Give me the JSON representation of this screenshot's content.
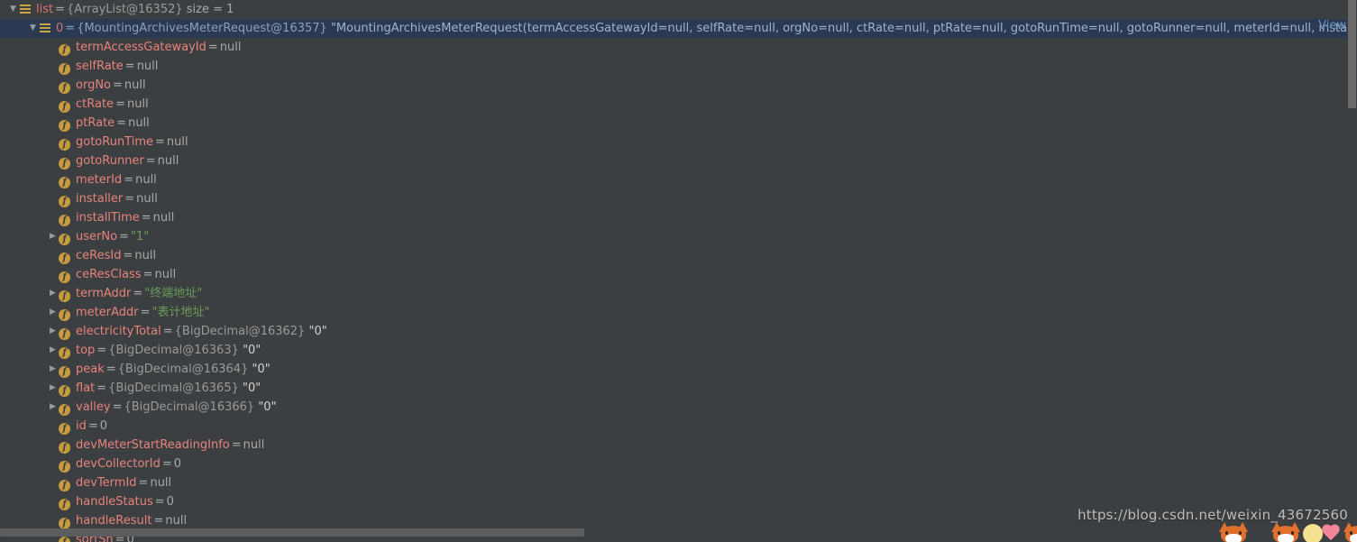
{
  "panel": {
    "background_color": "#3c3f41",
    "selection_color": "#2a3a52",
    "field_name_color": "#e8837b",
    "string_value_color": "#6a9c5a",
    "icon_gold_color": "#c79b3e"
  },
  "symbols": {
    "expanded": "▼",
    "collapsed": "▶",
    "field_icon_letter": "f",
    "equals": "=",
    "ellipsis": "…"
  },
  "rows": [
    {
      "indent": 0,
      "twisty": "expanded",
      "icon": "list-icon",
      "name": "list",
      "type": "{ArrayList@16352}",
      "value": "",
      "value_kind": "none",
      "extra": "size = 1",
      "selected": false
    },
    {
      "indent": 1,
      "twisty": "expanded",
      "icon": "list-icon",
      "name": "0",
      "type": "{MountingArchivesMeterRequest@16357}",
      "value": "\"MountingArchivesMeterRequest(termAccessGatewayId=null, selfRate=null, orgNo=null, ctRate=null, ptRate=null, gotoRunTime=null, gotoRunner=null, meterId=null, installer=null, installTime=nul",
      "value_kind": "desc",
      "extra": "",
      "selected": true
    },
    {
      "indent": 2,
      "twisty": "none",
      "icon": "field-icon",
      "name": "termAccessGatewayId",
      "type": "",
      "value": "null",
      "value_kind": "null",
      "extra": "",
      "selected": false
    },
    {
      "indent": 2,
      "twisty": "none",
      "icon": "field-icon",
      "name": "selfRate",
      "type": "",
      "value": "null",
      "value_kind": "null",
      "extra": "",
      "selected": false
    },
    {
      "indent": 2,
      "twisty": "none",
      "icon": "field-icon",
      "name": "orgNo",
      "type": "",
      "value": "null",
      "value_kind": "null",
      "extra": "",
      "selected": false
    },
    {
      "indent": 2,
      "twisty": "none",
      "icon": "field-icon",
      "name": "ctRate",
      "type": "",
      "value": "null",
      "value_kind": "null",
      "extra": "",
      "selected": false
    },
    {
      "indent": 2,
      "twisty": "none",
      "icon": "field-icon",
      "name": "ptRate",
      "type": "",
      "value": "null",
      "value_kind": "null",
      "extra": "",
      "selected": false
    },
    {
      "indent": 2,
      "twisty": "none",
      "icon": "field-icon",
      "name": "gotoRunTime",
      "type": "",
      "value": "null",
      "value_kind": "null",
      "extra": "",
      "selected": false
    },
    {
      "indent": 2,
      "twisty": "none",
      "icon": "field-icon",
      "name": "gotoRunner",
      "type": "",
      "value": "null",
      "value_kind": "null",
      "extra": "",
      "selected": false
    },
    {
      "indent": 2,
      "twisty": "none",
      "icon": "field-icon",
      "name": "meterId",
      "type": "",
      "value": "null",
      "value_kind": "null",
      "extra": "",
      "selected": false
    },
    {
      "indent": 2,
      "twisty": "none",
      "icon": "field-icon",
      "name": "installer",
      "type": "",
      "value": "null",
      "value_kind": "null",
      "extra": "",
      "selected": false
    },
    {
      "indent": 2,
      "twisty": "none",
      "icon": "field-icon",
      "name": "installTime",
      "type": "",
      "value": "null",
      "value_kind": "null",
      "extra": "",
      "selected": false
    },
    {
      "indent": 2,
      "twisty": "collapsed",
      "icon": "field-icon",
      "name": "userNo",
      "type": "",
      "value": "\"1\"",
      "value_kind": "string",
      "extra": "",
      "selected": false
    },
    {
      "indent": 2,
      "twisty": "none",
      "icon": "field-icon",
      "name": "ceResId",
      "type": "",
      "value": "null",
      "value_kind": "null",
      "extra": "",
      "selected": false
    },
    {
      "indent": 2,
      "twisty": "none",
      "icon": "field-icon",
      "name": "ceResClass",
      "type": "",
      "value": "null",
      "value_kind": "null",
      "extra": "",
      "selected": false
    },
    {
      "indent": 2,
      "twisty": "collapsed",
      "icon": "field-icon",
      "name": "termAddr",
      "type": "",
      "value": "\"终端地址\"",
      "value_kind": "string",
      "extra": "",
      "selected": false
    },
    {
      "indent": 2,
      "twisty": "collapsed",
      "icon": "field-icon",
      "name": "meterAddr",
      "type": "",
      "value": "\"表计地址\"",
      "value_kind": "string",
      "extra": "",
      "selected": false
    },
    {
      "indent": 2,
      "twisty": "collapsed",
      "icon": "field-icon",
      "name": "electricityTotal",
      "type": "{BigDecimal@16362}",
      "value": "\"0\"",
      "value_kind": "plain",
      "extra": "",
      "selected": false
    },
    {
      "indent": 2,
      "twisty": "collapsed",
      "icon": "field-icon",
      "name": "top",
      "type": "{BigDecimal@16363}",
      "value": "\"0\"",
      "value_kind": "plain",
      "extra": "",
      "selected": false
    },
    {
      "indent": 2,
      "twisty": "collapsed",
      "icon": "field-icon",
      "name": "peak",
      "type": "{BigDecimal@16364}",
      "value": "\"0\"",
      "value_kind": "plain",
      "extra": "",
      "selected": false
    },
    {
      "indent": 2,
      "twisty": "collapsed",
      "icon": "field-icon",
      "name": "flat",
      "type": "{BigDecimal@16365}",
      "value": "\"0\"",
      "value_kind": "plain",
      "extra": "",
      "selected": false
    },
    {
      "indent": 2,
      "twisty": "collapsed",
      "icon": "field-icon",
      "name": "valley",
      "type": "{BigDecimal@16366}",
      "value": "\"0\"",
      "value_kind": "plain",
      "extra": "",
      "selected": false
    },
    {
      "indent": 2,
      "twisty": "none",
      "icon": "field-icon",
      "name": "id",
      "type": "",
      "value": "0",
      "value_kind": "num",
      "extra": "",
      "selected": false
    },
    {
      "indent": 2,
      "twisty": "none",
      "icon": "field-icon",
      "name": "devMeterStartReadingInfo",
      "type": "",
      "value": "null",
      "value_kind": "null",
      "extra": "",
      "selected": false
    },
    {
      "indent": 2,
      "twisty": "none",
      "icon": "field-icon",
      "name": "devCollectorId",
      "type": "",
      "value": "0",
      "value_kind": "num",
      "extra": "",
      "selected": false
    },
    {
      "indent": 2,
      "twisty": "none",
      "icon": "field-icon",
      "name": "devTermId",
      "type": "",
      "value": "null",
      "value_kind": "null",
      "extra": "",
      "selected": false
    },
    {
      "indent": 2,
      "twisty": "none",
      "icon": "field-icon",
      "name": "handleStatus",
      "type": "",
      "value": "0",
      "value_kind": "num",
      "extra": "",
      "selected": false
    },
    {
      "indent": 2,
      "twisty": "none",
      "icon": "field-icon",
      "name": "handleResult",
      "type": "",
      "value": "null",
      "value_kind": "null",
      "extra": "",
      "selected": false
    },
    {
      "indent": 2,
      "twisty": "none",
      "icon": "field-icon",
      "name": "sortSn",
      "type": "",
      "value": "0",
      "value_kind": "num",
      "extra": "",
      "selected": false
    }
  ],
  "view_link": {
    "label": "View"
  },
  "watermark": {
    "url": "https://blog.csdn.net/weixin_43672560"
  }
}
